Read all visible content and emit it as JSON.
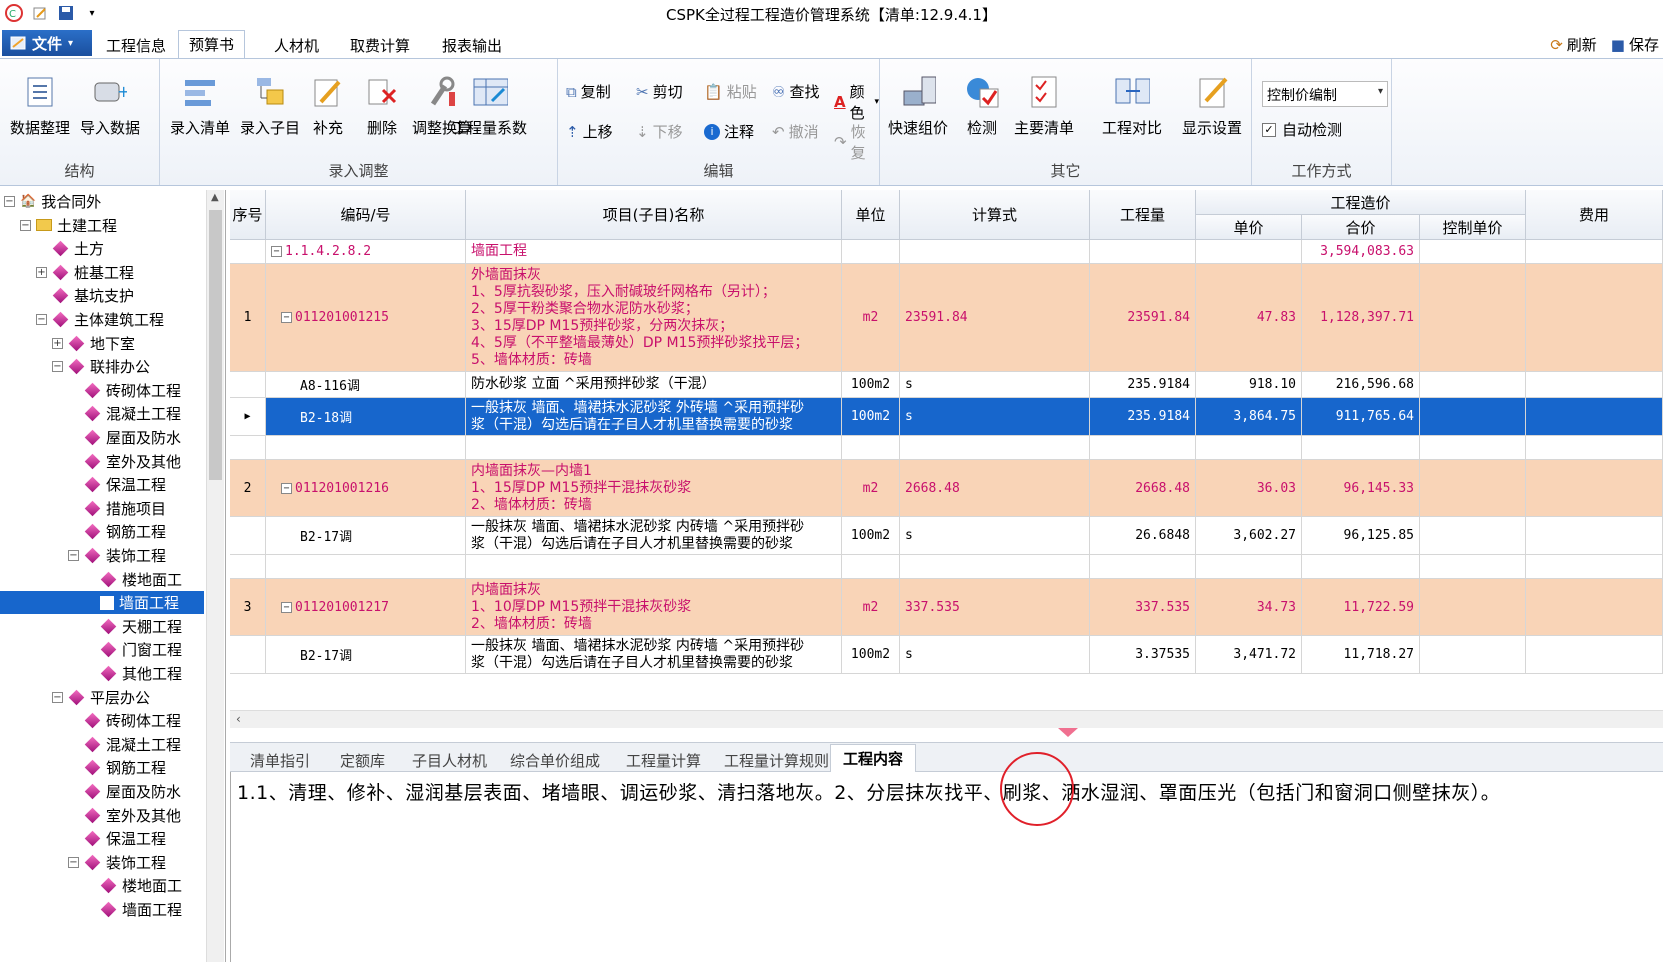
{
  "window": {
    "title": "CSPK全过程工程造价管理系统【清单:12.9.4.1】"
  },
  "menu": {
    "file_label": "文件",
    "tabs": [
      "工程信息",
      "预算书",
      "人材机",
      "取费计算",
      "报表输出"
    ],
    "active_tab": "预算书",
    "refresh_label": "刷新",
    "save_label": "保存"
  },
  "ribbon": {
    "groups": {
      "structure": "结构",
      "entry": "录入调整",
      "edit": "编辑",
      "other": "其它",
      "workmode": "工作方式"
    },
    "buttons": {
      "data_tidy": "数据整理",
      "import_data": "导入数据",
      "entry_list": "录入清单",
      "entry_sub": "录入子目",
      "supplement": "补充",
      "delete": "删除",
      "adjust_calc": "调整换算",
      "quantity_coef": "工程量系数",
      "copy": "复制",
      "cut": "剪切",
      "paste": "粘贴",
      "find": "查找",
      "color": "颜色",
      "move_up": "上移",
      "move_down": "下移",
      "note": "注释",
      "undo": "撤消",
      "redo": "恢复",
      "quick_group": "快速组价",
      "check": "检测",
      "main_list": "主要清单",
      "compare": "工程对比",
      "display_settings": "显示设置"
    },
    "mode_select": "控制价编制",
    "auto_check_label": "自动检测",
    "auto_check": true
  },
  "tree": {
    "nodes": [
      {
        "label": "我合同外",
        "level": 0,
        "expander": "-"
      },
      {
        "label": "土建工程",
        "level": 1,
        "expander": "-"
      },
      {
        "label": "土方",
        "level": 2,
        "expander": ""
      },
      {
        "label": "桩基工程",
        "level": 2,
        "expander": "+"
      },
      {
        "label": "基坑支护",
        "level": 2,
        "expander": ""
      },
      {
        "label": "主体建筑工程",
        "level": 2,
        "expander": "-"
      },
      {
        "label": "地下室",
        "level": 3,
        "expander": "+"
      },
      {
        "label": "联排办公",
        "level": 3,
        "expander": "-"
      },
      {
        "label": "砖砌体工程",
        "level": 4,
        "expander": ""
      },
      {
        "label": "混凝土工程",
        "level": 4,
        "expander": ""
      },
      {
        "label": "屋面及防水",
        "level": 4,
        "expander": ""
      },
      {
        "label": "室外及其他",
        "level": 4,
        "expander": ""
      },
      {
        "label": "保温工程",
        "level": 4,
        "expander": ""
      },
      {
        "label": "措施项目",
        "level": 4,
        "expander": ""
      },
      {
        "label": "钢筋工程",
        "level": 4,
        "expander": ""
      },
      {
        "label": "装饰工程",
        "level": 4,
        "expander": "-"
      },
      {
        "label": "楼地面工",
        "level": 5,
        "expander": ""
      },
      {
        "label": "墙面工程",
        "level": 5,
        "expander": "",
        "selected": true
      },
      {
        "label": "天棚工程",
        "level": 5,
        "expander": ""
      },
      {
        "label": "门窗工程",
        "level": 5,
        "expander": ""
      },
      {
        "label": "其他工程",
        "level": 5,
        "expander": ""
      },
      {
        "label": "平层办公",
        "level": 3,
        "expander": "-"
      },
      {
        "label": "砖砌体工程",
        "level": 4,
        "expander": ""
      },
      {
        "label": "混凝土工程",
        "level": 4,
        "expander": ""
      },
      {
        "label": "钢筋工程",
        "level": 4,
        "expander": ""
      },
      {
        "label": "屋面及防水",
        "level": 4,
        "expander": ""
      },
      {
        "label": "室外及其他",
        "level": 4,
        "expander": ""
      },
      {
        "label": "保温工程",
        "level": 4,
        "expander": ""
      },
      {
        "label": "装饰工程",
        "level": 4,
        "expander": "-"
      },
      {
        "label": "楼地面工",
        "level": 5,
        "expander": ""
      },
      {
        "label": "墙面工程",
        "level": 5,
        "expander": ""
      }
    ]
  },
  "grid": {
    "headers": {
      "seq": "序号",
      "code": "编码/号",
      "name": "项目(子目)名称",
      "unit": "单位",
      "formula": "计算式",
      "qty": "工程量",
      "cost_group": "工程造价",
      "unit_price": "单价",
      "total": "合价",
      "ctrl_price": "控制单价",
      "fee": "费用"
    },
    "rows": [
      {
        "type": "top",
        "seq": "",
        "code": "1.1.4.2.8.2",
        "name": "墙面工程",
        "unit": "",
        "formula": "",
        "qty": "",
        "unit_price": "",
        "total": "3,594,083.63"
      },
      {
        "type": "list",
        "seq": "1",
        "code": "011201001215",
        "name": "外墙面抹灰\n1、5厚抗裂砂浆，压入耐碱玻纤网格布（另计）；\n2、5厚干粉类聚合物水泥防水砂浆；\n3、15厚DP M15预拌砂浆，分两次抹灰；\n4、5厚（不平整墙最薄处）DP M15预拌砂浆找平层；\n5、墙体材质：砖墙",
        "unit": "m2",
        "formula": "23591.84",
        "qty": "23591.84",
        "unit_price": "47.83",
        "total": "1,128,397.71"
      },
      {
        "type": "sub",
        "seq": "",
        "code": "A8-116调",
        "name": "防水砂浆 立面  ^采用预拌砂浆（干混）",
        "unit": "100m2",
        "formula": "s",
        "qty": "235.9184",
        "unit_price": "918.10",
        "total": "216,596.68"
      },
      {
        "type": "selected",
        "seq": "",
        "code": "B2-18调",
        "name": "一般抹灰 墙面、墙裙抹水泥砂浆 外砖墙  ^采用预拌砂\n浆（干混）勾选后请在子目人才机里替换需要的砂浆",
        "unit": "100m2",
        "formula": "s",
        "qty": "235.9184",
        "unit_price": "3,864.75",
        "total": "911,765.64"
      },
      {
        "type": "blank",
        "seq": "",
        "code": "",
        "name": "",
        "unit": "",
        "formula": "",
        "qty": "",
        "unit_price": "",
        "total": ""
      },
      {
        "type": "list",
        "seq": "2",
        "code": "011201001216",
        "name": "内墙面抹灰—内墙1\n1、15厚DP M15预拌干混抹灰砂浆\n2、墙体材质：砖墙",
        "unit": "m2",
        "formula": "2668.48",
        "qty": "2668.48",
        "unit_price": "36.03",
        "total": "96,145.33"
      },
      {
        "type": "sub",
        "seq": "",
        "code": "B2-17调",
        "name": "一般抹灰 墙面、墙裙抹水泥砂浆 内砖墙  ^采用预拌砂\n浆（干混）勾选后请在子目人才机里替换需要的砂浆",
        "unit": "100m2",
        "formula": "s",
        "qty": "26.6848",
        "unit_price": "3,602.27",
        "total": "96,125.85"
      },
      {
        "type": "blank",
        "seq": "",
        "code": "",
        "name": "",
        "unit": "",
        "formula": "",
        "qty": "",
        "unit_price": "",
        "total": ""
      },
      {
        "type": "list",
        "seq": "3",
        "code": "011201001217",
        "name": "内墙面抹灰\n1、10厚DP M15预拌干混抹灰砂浆\n2、墙体材质：砖墙",
        "unit": "m2",
        "formula": "337.535",
        "qty": "337.535",
        "unit_price": "34.73",
        "total": "11,722.59"
      },
      {
        "type": "sub",
        "seq": "",
        "code": "B2-17调",
        "name": "一般抹灰 墙面、墙裙抹水泥砂浆 内砖墙  ^采用预拌砂\n浆（干混）勾选后请在子目人才机里替换需要的砂浆",
        "unit": "100m2",
        "formula": "s",
        "qty": "3.37535",
        "unit_price": "3,471.72",
        "total": "11,718.27"
      }
    ]
  },
  "bottom_tabs": {
    "tabs": [
      "清单指引",
      "定额库",
      "子目人材机",
      "综合单价组成",
      "工程量计算",
      "工程量计算规则",
      "工程内容"
    ],
    "active": "工程内容",
    "content": "1.1、清理、修补、湿润基层表面、堵墙眼、调运砂浆、清扫落地灰。2、分层抹灰找平、刷浆、洒水湿润、罩面压光（包括门和窗洞口侧壁抹灰）。"
  },
  "colors": {
    "accent": "#1766cc",
    "list_row": "#f9d4b7",
    "code_text": "#c8106c",
    "annotation": "#e0202a"
  }
}
